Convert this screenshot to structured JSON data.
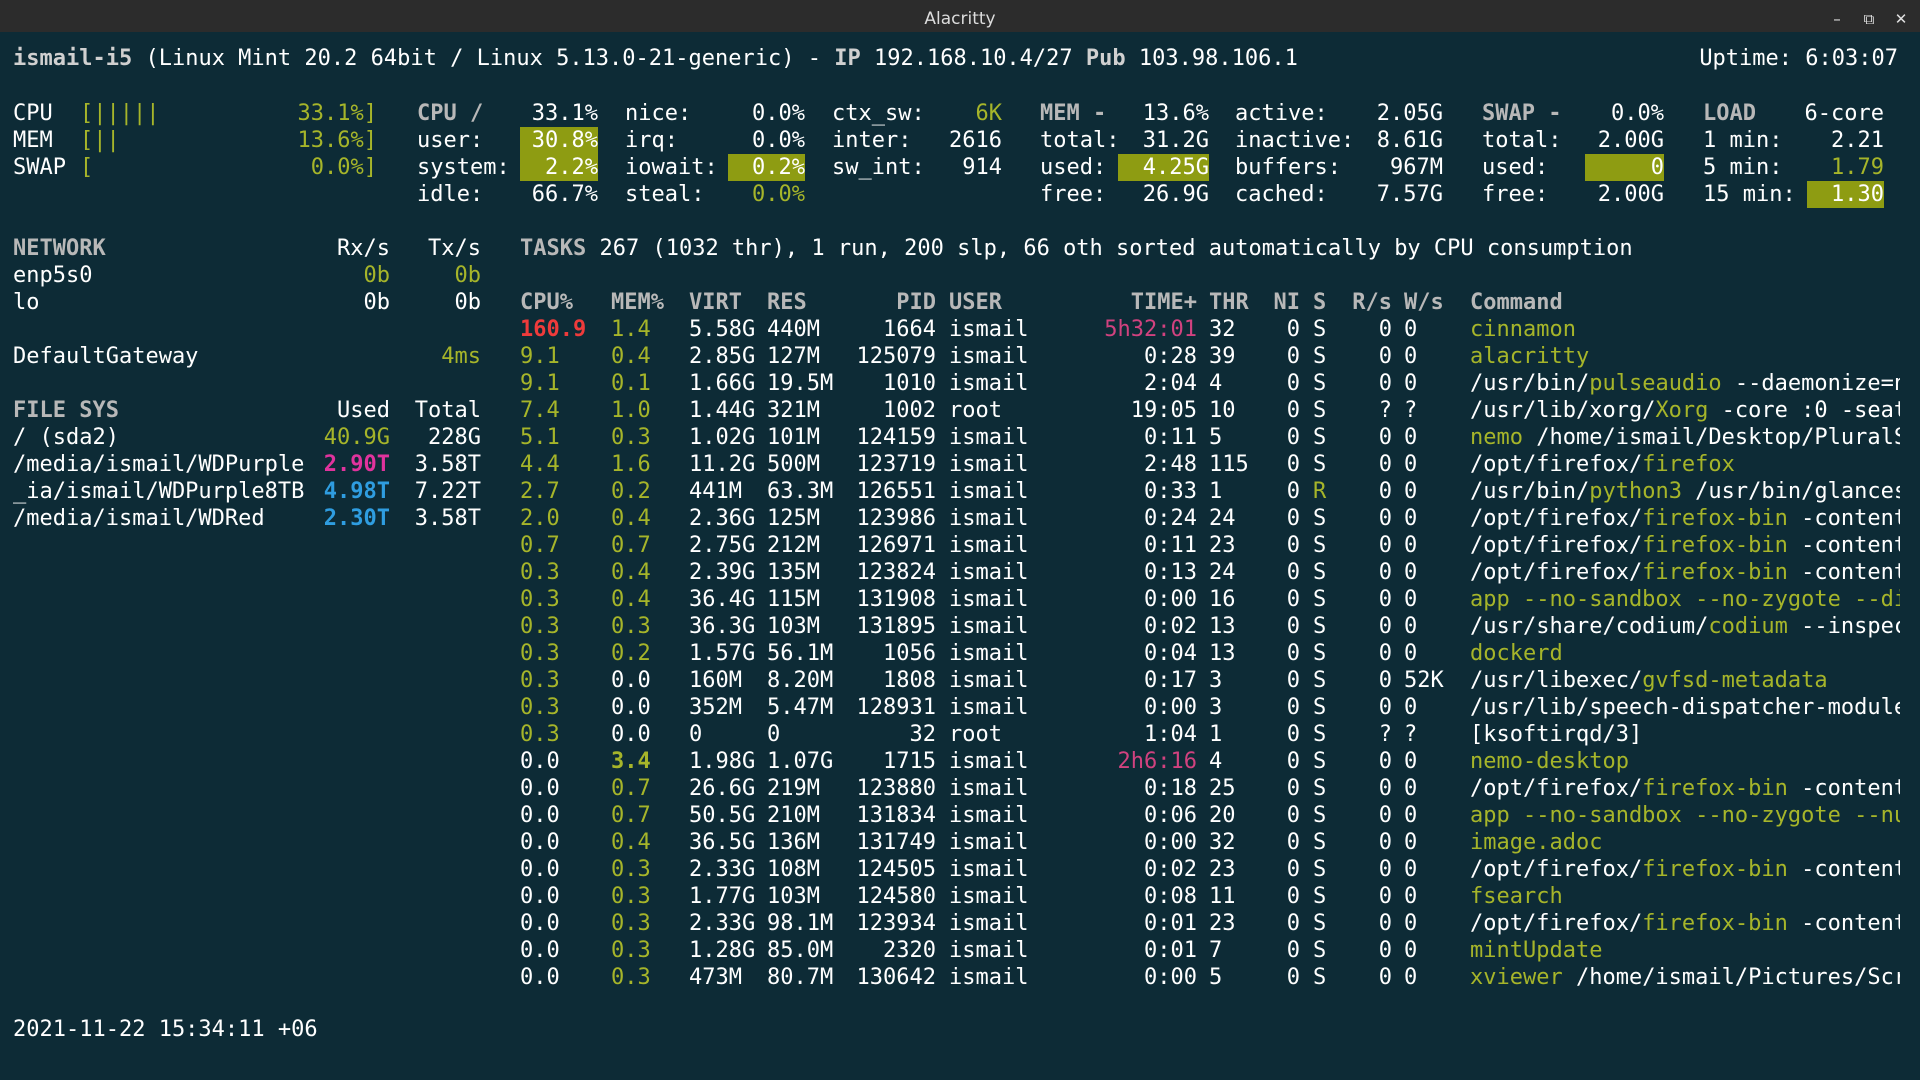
{
  "window": {
    "title": "Alacritty"
  },
  "header": {
    "host": "ismail-i5",
    "system": "(Linux Mint 20.2 64bit / Linux 5.13.0-21-generic) -",
    "ip_label": "IP",
    "ip": "192.168.10.4/27",
    "pub_label": "Pub",
    "pub": "103.98.106.1",
    "uptime": "Uptime: 6:03:07"
  },
  "quicklook": [
    {
      "label": "CPU",
      "bar": "[|||||",
      "value": "33.1%]"
    },
    {
      "label": "MEM",
      "bar": "[||",
      "value": "13.6%]"
    },
    {
      "label": "SWAP",
      "bar": "[",
      "value": "0.0%]"
    }
  ],
  "cpu": {
    "title": "CPU /",
    "total": "33.1%",
    "user_l": "user:",
    "user": "30.8%",
    "system_l": "system:",
    "system": "2.2%",
    "idle_l": "idle:",
    "idle": "66.7%",
    "nice_l": "nice:",
    "nice": "0.0%",
    "irq_l": "irq:",
    "irq": "0.0%",
    "iowait_l": "iowait:",
    "iowait": "0.2%",
    "steal_l": "steal:",
    "steal": "0.0%",
    "ctx_sw_l": "ctx_sw:",
    "ctx_sw": "6K",
    "inter_l": "inter:",
    "inter": "2616",
    "sw_int_l": "sw_int:",
    "sw_int": "914"
  },
  "mem": {
    "title": "MEM -",
    "percent": "13.6%",
    "total_l": "total:",
    "total": "31.2G",
    "used_l": "used:",
    "used": "4.25G",
    "free_l": "free:",
    "free": "26.9G",
    "active_l": "active:",
    "active": "2.05G",
    "inactive_l": "inactive:",
    "inactive": "8.61G",
    "buffers_l": "buffers:",
    "buffers": "967M",
    "cached_l": "cached:",
    "cached": "7.57G"
  },
  "swap": {
    "title": "SWAP -",
    "percent": "0.0%",
    "total_l": "total:",
    "total": "2.00G",
    "used_l": "used:",
    "used": "0",
    "free_l": "free:",
    "free": "2.00G"
  },
  "load": {
    "title": "LOAD",
    "cores": "6-core",
    "m1_l": "1 min:",
    "m1": "2.21",
    "m5_l": "5 min:",
    "m5": "1.79",
    "m15_l": "15 min:",
    "m15": "1.30"
  },
  "network": {
    "title": "NETWORK",
    "rx_h": "Rx/s",
    "tx_h": "Tx/s",
    "rows": [
      {
        "name": "enp5s0",
        "rx": "0b",
        "tx": "0b"
      },
      {
        "name": "lo",
        "rx": "0b",
        "tx": "0b"
      }
    ],
    "gateway_label": "DefaultGateway",
    "gateway": "4ms"
  },
  "filesys": {
    "title": "FILE SYS",
    "used_h": "Used",
    "total_h": "Total",
    "rows": [
      {
        "name": "/ (sda2)",
        "used": "40.9G",
        "total": "228G"
      },
      {
        "name": "/media/ismail/WDPurple",
        "used": "2.90T",
        "total": "3.58T"
      },
      {
        "name": "_ia/ismail/WDPurple8TB",
        "used": "4.98T",
        "total": "7.22T"
      },
      {
        "name": "/media/ismail/WDRed",
        "used": "2.30T",
        "total": "3.58T"
      }
    ]
  },
  "tasks": {
    "label": "TASKS",
    "summary": "267 (1032 thr), 1 run, 200 slp, 66 oth sorted automatically by CPU consumption"
  },
  "columns": {
    "cpu": "CPU%",
    "mem": "MEM%",
    "virt": "VIRT",
    "res": "RES",
    "pid": "PID",
    "user": "USER",
    "time": "TIME+",
    "thr": "THR",
    "ni": "NI",
    "s": "S",
    "rs": "R/s",
    "ws": "W/s",
    "cmd": "Command"
  },
  "processes": [
    {
      "cpu": "160.9",
      "mem": "1.4",
      "virt": "5.58G",
      "res": "440M",
      "pid": "1664",
      "user": "ismail",
      "time": "5h32:01",
      "thr": "32",
      "ni": "0",
      "s": "S",
      "rs": "0",
      "ws": "0",
      "cmd_pre": "",
      "cmd_hl": "cinnamon",
      "cmd_post": ""
    },
    {
      "cpu": "9.1",
      "mem": "0.4",
      "virt": "2.85G",
      "res": "127M",
      "pid": "125079",
      "user": "ismail",
      "time": "0:28",
      "thr": "39",
      "ni": "0",
      "s": "S",
      "rs": "0",
      "ws": "0",
      "cmd_pre": "",
      "cmd_hl": "alacritty",
      "cmd_post": ""
    },
    {
      "cpu": "9.1",
      "mem": "0.1",
      "virt": "1.66G",
      "res": "19.5M",
      "pid": "1010",
      "user": "ismail",
      "time": "2:04",
      "thr": "4",
      "ni": "0",
      "s": "S",
      "rs": "0",
      "ws": "0",
      "cmd_pre": "/usr/bin/",
      "cmd_hl": "pulseaudio",
      "cmd_post": " --daemonize=n"
    },
    {
      "cpu": "7.4",
      "mem": "1.0",
      "virt": "1.44G",
      "res": "321M",
      "pid": "1002",
      "user": "root",
      "time": "19:05",
      "thr": "10",
      "ni": "0",
      "s": "S",
      "rs": "?",
      "ws": "?",
      "cmd_pre": "/usr/lib/xorg/",
      "cmd_hl": "Xorg",
      "cmd_post": " -core :0 -seat"
    },
    {
      "cpu": "5.1",
      "mem": "0.3",
      "virt": "1.02G",
      "res": "101M",
      "pid": "124159",
      "user": "ismail",
      "time": "0:11",
      "thr": "5",
      "ni": "0",
      "s": "S",
      "rs": "0",
      "ws": "0",
      "cmd_pre": "",
      "cmd_hl": "nemo",
      "cmd_post": " /home/ismail/Desktop/PluralS"
    },
    {
      "cpu": "4.4",
      "mem": "1.6",
      "virt": "11.2G",
      "res": "500M",
      "pid": "123719",
      "user": "ismail",
      "time": "2:48",
      "thr": "115",
      "ni": "0",
      "s": "S",
      "rs": "0",
      "ws": "0",
      "cmd_pre": "/opt/firefox/",
      "cmd_hl": "firefox",
      "cmd_post": ""
    },
    {
      "cpu": "2.7",
      "mem": "0.2",
      "virt": "441M",
      "res": "63.3M",
      "pid": "126551",
      "user": "ismail",
      "time": "0:33",
      "thr": "1",
      "ni": "0",
      "s": "R",
      "rs": "0",
      "ws": "0",
      "cmd_pre": "/usr/bin/",
      "cmd_hl": "python3",
      "cmd_post": " /usr/bin/glances"
    },
    {
      "cpu": "2.0",
      "mem": "0.4",
      "virt": "2.36G",
      "res": "125M",
      "pid": "123986",
      "user": "ismail",
      "time": "0:24",
      "thr": "24",
      "ni": "0",
      "s": "S",
      "rs": "0",
      "ws": "0",
      "cmd_pre": "/opt/firefox/",
      "cmd_hl": "firefox-bin",
      "cmd_post": " -content"
    },
    {
      "cpu": "0.7",
      "mem": "0.7",
      "virt": "2.75G",
      "res": "212M",
      "pid": "126971",
      "user": "ismail",
      "time": "0:11",
      "thr": "23",
      "ni": "0",
      "s": "S",
      "rs": "0",
      "ws": "0",
      "cmd_pre": "/opt/firefox/",
      "cmd_hl": "firefox-bin",
      "cmd_post": " -content"
    },
    {
      "cpu": "0.3",
      "mem": "0.4",
      "virt": "2.39G",
      "res": "135M",
      "pid": "123824",
      "user": "ismail",
      "time": "0:13",
      "thr": "24",
      "ni": "0",
      "s": "S",
      "rs": "0",
      "ws": "0",
      "cmd_pre": "/opt/firefox/",
      "cmd_hl": "firefox-bin",
      "cmd_post": " -content"
    },
    {
      "cpu": "0.3",
      "mem": "0.4",
      "virt": "36.4G",
      "res": "115M",
      "pid": "131908",
      "user": "ismail",
      "time": "0:00",
      "thr": "16",
      "ni": "0",
      "s": "S",
      "rs": "0",
      "ws": "0",
      "cmd_pre": "",
      "cmd_hl": "app --no-sandbox --no-zygote --di",
      "cmd_post": ""
    },
    {
      "cpu": "0.3",
      "mem": "0.3",
      "virt": "36.3G",
      "res": "103M",
      "pid": "131895",
      "user": "ismail",
      "time": "0:02",
      "thr": "13",
      "ni": "0",
      "s": "S",
      "rs": "0",
      "ws": "0",
      "cmd_pre": "/usr/share/codium/",
      "cmd_hl": "codium",
      "cmd_post": " --inspec"
    },
    {
      "cpu": "0.3",
      "mem": "0.2",
      "virt": "1.57G",
      "res": "56.1M",
      "pid": "1056",
      "user": "ismail",
      "time": "0:04",
      "thr": "13",
      "ni": "0",
      "s": "S",
      "rs": "0",
      "ws": "0",
      "cmd_pre": "",
      "cmd_hl": "dockerd",
      "cmd_post": ""
    },
    {
      "cpu": "0.3",
      "mem": "0.0",
      "virt": "160M",
      "res": "8.20M",
      "pid": "1808",
      "user": "ismail",
      "time": "0:17",
      "thr": "3",
      "ni": "0",
      "s": "S",
      "rs": "0",
      "ws": "52K",
      "cmd_pre": "/usr/libexec/",
      "cmd_hl": "gvfsd-metadata",
      "cmd_post": ""
    },
    {
      "cpu": "0.3",
      "mem": "0.0",
      "virt": "352M",
      "res": "5.47M",
      "pid": "128931",
      "user": "ismail",
      "time": "0:00",
      "thr": "3",
      "ni": "0",
      "s": "S",
      "rs": "0",
      "ws": "0",
      "cmd_pre": "/usr/lib/speech-dispatcher-module",
      "cmd_hl": "",
      "cmd_post": ""
    },
    {
      "cpu": "0.3",
      "mem": "0.0",
      "virt": "0",
      "res": "0",
      "pid": "32",
      "user": "root",
      "time": "1:04",
      "thr": "1",
      "ni": "0",
      "s": "S",
      "rs": "?",
      "ws": "?",
      "cmd_pre": "[ksoftirqd/3]",
      "cmd_hl": "",
      "cmd_post": ""
    },
    {
      "cpu": "0.0",
      "mem": "3.4",
      "virt": "1.98G",
      "res": "1.07G",
      "pid": "1715",
      "user": "ismail",
      "time": "2h6:16",
      "thr": "4",
      "ni": "0",
      "s": "S",
      "rs": "0",
      "ws": "0",
      "cmd_pre": "",
      "cmd_hl": "nemo-desktop",
      "cmd_post": ""
    },
    {
      "cpu": "0.0",
      "mem": "0.7",
      "virt": "26.6G",
      "res": "219M",
      "pid": "123880",
      "user": "ismail",
      "time": "0:18",
      "thr": "25",
      "ni": "0",
      "s": "S",
      "rs": "0",
      "ws": "0",
      "cmd_pre": "/opt/firefox/",
      "cmd_hl": "firefox-bin",
      "cmd_post": " -content"
    },
    {
      "cpu": "0.0",
      "mem": "0.7",
      "virt": "50.5G",
      "res": "210M",
      "pid": "131834",
      "user": "ismail",
      "time": "0:06",
      "thr": "20",
      "ni": "0",
      "s": "S",
      "rs": "0",
      "ws": "0",
      "cmd_pre": "",
      "cmd_hl": "app --no-sandbox --no-zygote --nu",
      "cmd_post": ""
    },
    {
      "cpu": "0.0",
      "mem": "0.4",
      "virt": "36.5G",
      "res": "136M",
      "pid": "131749",
      "user": "ismail",
      "time": "0:00",
      "thr": "32",
      "ni": "0",
      "s": "S",
      "rs": "0",
      "ws": "0",
      "cmd_pre": "",
      "cmd_hl": "image.adoc",
      "cmd_post": ""
    },
    {
      "cpu": "0.0",
      "mem": "0.3",
      "virt": "2.33G",
      "res": "108M",
      "pid": "124505",
      "user": "ismail",
      "time": "0:02",
      "thr": "23",
      "ni": "0",
      "s": "S",
      "rs": "0",
      "ws": "0",
      "cmd_pre": "/opt/firefox/",
      "cmd_hl": "firefox-bin",
      "cmd_post": " -content"
    },
    {
      "cpu": "0.0",
      "mem": "0.3",
      "virt": "1.77G",
      "res": "103M",
      "pid": "124580",
      "user": "ismail",
      "time": "0:08",
      "thr": "11",
      "ni": "0",
      "s": "S",
      "rs": "0",
      "ws": "0",
      "cmd_pre": "",
      "cmd_hl": "fsearch",
      "cmd_post": ""
    },
    {
      "cpu": "0.0",
      "mem": "0.3",
      "virt": "2.33G",
      "res": "98.1M",
      "pid": "123934",
      "user": "ismail",
      "time": "0:01",
      "thr": "23",
      "ni": "0",
      "s": "S",
      "rs": "0",
      "ws": "0",
      "cmd_pre": "/opt/firefox/",
      "cmd_hl": "firefox-bin",
      "cmd_post": " -content"
    },
    {
      "cpu": "0.0",
      "mem": "0.3",
      "virt": "1.28G",
      "res": "85.0M",
      "pid": "2320",
      "user": "ismail",
      "time": "0:01",
      "thr": "7",
      "ni": "0",
      "s": "S",
      "rs": "0",
      "ws": "0",
      "cmd_pre": "",
      "cmd_hl": "mintUpdate",
      "cmd_post": ""
    },
    {
      "cpu": "0.0",
      "mem": "0.3",
      "virt": "473M",
      "res": "80.7M",
      "pid": "130642",
      "user": "ismail",
      "time": "0:00",
      "thr": "5",
      "ni": "0",
      "s": "S",
      "rs": "0",
      "ws": "0",
      "cmd_pre": "",
      "cmd_hl": "xviewer",
      "cmd_post": " /home/ismail/Pictures/Scr"
    }
  ],
  "footer": {
    "datetime": "2021-11-22 15:34:11 +06"
  },
  "colors": {
    "background": "#0d2b36",
    "green": "#a6b52a",
    "highlight": "#8e9c12",
    "red": "#ef3b3b",
    "pink": "#e0339d",
    "blue": "#2f9de0"
  }
}
